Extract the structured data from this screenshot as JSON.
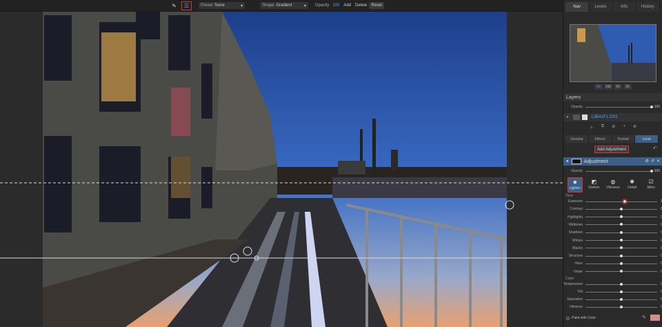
{
  "toolbar": {
    "preset_label": "Preset",
    "preset_value": "None",
    "shape_label": "Shape",
    "shape_value": "Gradient",
    "opacity_label": "Opacity",
    "opacity_value": "100",
    "add": "Add",
    "delete": "Delete",
    "reset": "Reset"
  },
  "panel_tabs": [
    "Nav",
    "Levels",
    "Info",
    "History"
  ],
  "zoom_buttons": [
    "Fit",
    "100",
    "50",
    "25"
  ],
  "layers": {
    "title": "Layers",
    "opacity_label": "Opacity",
    "opacity_value": "100",
    "layer_name": "L3B41F1.CR2"
  },
  "mode_tabs": [
    "Develop",
    "Effects",
    "Portrait",
    "Local"
  ],
  "add_adjustment": "Add Adjustment",
  "adjustment": {
    "title": "Adjustment",
    "opacity_label": "Opacity",
    "opacity_value": "100"
  },
  "brushes": [
    {
      "label": "Lighten",
      "icon": "lighten-icon"
    },
    {
      "label": "Darken",
      "icon": "darken-icon"
    },
    {
      "label": "Vibrance",
      "icon": "vibrance-icon"
    },
    {
      "label": "Detail",
      "icon": "detail-icon"
    },
    {
      "label": "More",
      "icon": "more-icon"
    }
  ],
  "tone_label": "Tone:",
  "tone": [
    {
      "label": "Exposure",
      "value": "1",
      "pos": 0.55
    },
    {
      "label": "Contrast",
      "value": "0",
      "pos": 0.5
    },
    {
      "label": "Highlights",
      "value": "0",
      "pos": 0.5
    },
    {
      "label": "Midtones",
      "value": "0",
      "pos": 0.5
    },
    {
      "label": "Shadows",
      "value": "0",
      "pos": 0.5
    },
    {
      "label": "Whites",
      "value": "0",
      "pos": 0.5
    },
    {
      "label": "Blacks",
      "value": "0",
      "pos": 0.5
    },
    {
      "label": "Structure",
      "value": "0",
      "pos": 0.5
    },
    {
      "label": "Haze",
      "value": "0",
      "pos": 0.5
    },
    {
      "label": "Noise",
      "value": "0",
      "pos": 0.5
    }
  ],
  "color_label": "Color:",
  "color": [
    {
      "label": "Temperature",
      "value": "0",
      "pos": 0.5
    },
    {
      "label": "Tint",
      "value": "0",
      "pos": 0.5
    },
    {
      "label": "Saturation",
      "value": "0",
      "pos": 0.5
    },
    {
      "label": "Vibrance",
      "value": "0",
      "pos": 0.5
    }
  ],
  "paint_with_color": "Paint with Color",
  "colors": {
    "accent": "#4aa3ff",
    "highlight_border": "#dd3333",
    "swatch": "#d98b8b"
  }
}
